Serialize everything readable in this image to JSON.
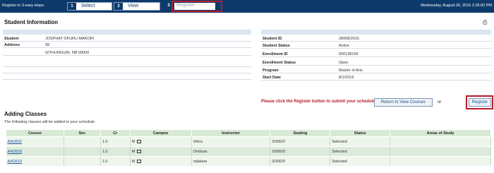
{
  "topbar": {
    "lead": "Register in 3 easy steps.",
    "steps": [
      {
        "num": "1",
        "label": "Select"
      },
      {
        "num": "2",
        "label": "View"
      },
      {
        "num": "3",
        "label": "Register"
      }
    ],
    "datetime": "Wednesday, August 26, 2015 2:25:02 PM"
  },
  "student_info": {
    "title": "Student Information",
    "left": [
      {
        "key": "Student",
        "value": "JOSPHAT OFURU MAKORI"
      },
      {
        "key": "Address",
        "value": "99"
      },
      {
        "key": "",
        "value": "GITHUNGURI, NB 00000"
      }
    ],
    "right": [
      {
        "key": "Student ID",
        "value": "28008/2015"
      },
      {
        "key": "Student Status",
        "value": "Active"
      },
      {
        "key": "Enrollment ID",
        "value": "000138199"
      },
      {
        "key": "Enrollment Status",
        "value": "Open"
      },
      {
        "key": "Program",
        "value": "Master of Arts"
      },
      {
        "key": "Start Date",
        "value": "8/1/2015"
      }
    ]
  },
  "cta": {
    "message": "Please click the Register button to submit your schedule.",
    "return_label": "Return to View Courses",
    "or": "or",
    "register_label": "Register"
  },
  "classes": {
    "title": "Adding Classes",
    "subtitle": "The following classes will be added to your schedule.",
    "columns": [
      "Course",
      "Sec",
      "Cr",
      "Campus",
      "Instructor",
      "Seating",
      "Status",
      "Areas of Study"
    ],
    "rows": [
      {
        "course": "AAD802",
        "sec": "",
        "cr": "1.0",
        "campus": "M",
        "instructor": "Vikiru",
        "seating": "0/300/0",
        "status": "Selected",
        "areas": ""
      },
      {
        "course": "AAD818",
        "sec": "",
        "cr": "1.0",
        "campus": "M",
        "instructor": "Ombura",
        "seating": "0/300/0",
        "status": "Selected",
        "areas": ""
      },
      {
        "course": "AAD819",
        "sec": "",
        "cr": "1.0",
        "campus": "M",
        "instructor": "ndakare",
        "seating": "0/300/0",
        "status": "Selected",
        "areas": ""
      }
    ]
  },
  "colors": {
    "topbar": "#0d3a6b",
    "highlight": "#b51d2b",
    "table_header": "#d8ead5"
  }
}
